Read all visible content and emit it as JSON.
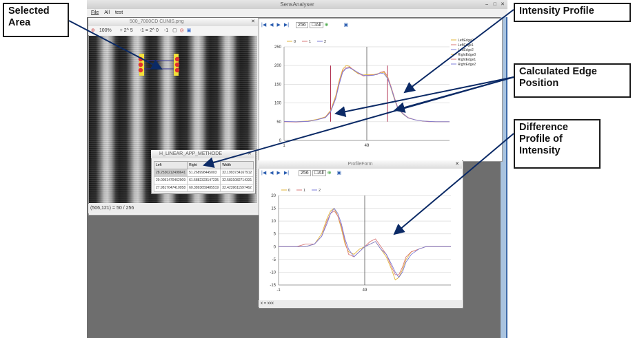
{
  "app": {
    "title": "SensAnalyser",
    "menu": [
      "File",
      "All",
      "test"
    ],
    "window_buttons": [
      "–",
      "□",
      "✕"
    ]
  },
  "image_window": {
    "title": "500_7000CD CUNIS.png",
    "toolbar": {
      "zoom": "100%",
      "gain": "+ 2^ 5",
      "offset": "-1 = 2^ 0",
      "step": "-1"
    },
    "status": "(506,121) = 50 / 256"
  },
  "table_window": {
    "title": "H_LINEAR_APP_METHODE",
    "headers": [
      "Left",
      "Right",
      "Width"
    ],
    "rows": [
      [
        "28.2536212498641",
        "51.268998445003",
        "32.1993734167912"
      ],
      [
        "29.0051470462909",
        "61.5882323147235",
        "32.5831082714331"
      ],
      [
        "27.9817047410958",
        "60.3893659485519",
        "32.4239611597462"
      ]
    ]
  },
  "profile_window": {
    "toolbar": {
      "range": "256",
      "all_label": "All"
    },
    "legend_top": [
      "0",
      "1",
      "2"
    ],
    "legend_right": [
      "LeftEdge0",
      "LeftEdge1",
      "LeftEdge2",
      "RightEdge0",
      "RightEdge1",
      "RightEdge2"
    ]
  },
  "diff_window": {
    "title": "ProfileForm",
    "toolbar": {
      "range": "256",
      "all_label": "All"
    },
    "legend_top": [
      "0",
      "1",
      "2"
    ],
    "status": "x = xxx"
  },
  "callouts": {
    "selected_area": "Selected Area",
    "intensity_profile": "Intensity Profile",
    "edge_position": "Calculated Edge Position",
    "difference_profile": "Difference Profile of Intensity"
  },
  "colors": {
    "series0": "#e2b43a",
    "series1": "#d87a7a",
    "series2": "#7b7bd8",
    "edge": "#b03050",
    "arrow": "#0b2a66"
  },
  "chart_data": [
    {
      "type": "line",
      "title": "",
      "xlabel": "",
      "ylabel": "",
      "xlim": [
        1,
        97
      ],
      "ylim": [
        0,
        250
      ],
      "x_ticks": [
        "1",
        "49"
      ],
      "y_ticks": [
        "0",
        "50",
        "100",
        "150",
        "200",
        "250"
      ],
      "grid": true,
      "legend": "top-right",
      "series": [
        {
          "name": "0",
          "x": [
            1,
            8,
            15,
            20,
            25,
            28,
            31,
            33,
            35,
            37,
            39,
            41,
            44,
            47,
            50,
            53,
            55,
            57,
            59,
            61,
            63,
            65,
            67,
            70,
            73,
            77,
            81,
            85,
            89,
            93,
            97
          ],
          "values": [
            50,
            50,
            52,
            56,
            63,
            80,
            120,
            160,
            190,
            200,
            198,
            188,
            178,
            175,
            176,
            176,
            178,
            180,
            182,
            168,
            140,
            110,
            85,
            70,
            60,
            55,
            52,
            51,
            50,
            50,
            50
          ]
        },
        {
          "name": "1",
          "x": [
            1,
            8,
            15,
            20,
            25,
            28,
            31,
            33,
            35,
            37,
            39,
            41,
            44,
            47,
            50,
            53,
            55,
            57,
            59,
            61,
            63,
            65,
            67,
            70,
            73,
            77,
            81,
            85,
            89,
            93,
            97
          ],
          "values": [
            50,
            49,
            51,
            55,
            62,
            78,
            115,
            155,
            185,
            195,
            196,
            190,
            180,
            172,
            174,
            175,
            176,
            182,
            185,
            172,
            145,
            115,
            88,
            72,
            61,
            55,
            52,
            50,
            50,
            50,
            50
          ]
        },
        {
          "name": "2",
          "x": [
            1,
            8,
            15,
            20,
            25,
            28,
            31,
            33,
            35,
            37,
            39,
            41,
            44,
            47,
            50,
            53,
            55,
            57,
            59,
            61,
            63,
            65,
            67,
            70,
            73,
            77,
            81,
            85,
            89,
            93,
            97
          ],
          "values": [
            51,
            50,
            51,
            55,
            61,
            76,
            112,
            150,
            182,
            192,
            194,
            189,
            181,
            174,
            173,
            174,
            177,
            180,
            178,
            166,
            142,
            112,
            86,
            71,
            60,
            55,
            52,
            51,
            50,
            50,
            50
          ]
        }
      ],
      "edges": {
        "left": 28,
        "right": 61,
        "range": [
          50,
          200
        ]
      }
    },
    {
      "type": "line",
      "title": "",
      "xlabel": "",
      "ylabel": "",
      "xlim": [
        1,
        97
      ],
      "ylim": [
        -15,
        20
      ],
      "x_ticks": [
        "-1",
        "49"
      ],
      "y_ticks": [
        "-15",
        "-10",
        "-5",
        "0",
        "5",
        "10",
        "15",
        "20"
      ],
      "grid": true,
      "legend": "top-left",
      "series": [
        {
          "name": "0",
          "x": [
            1,
            6,
            11,
            16,
            21,
            25,
            28,
            30,
            32,
            34,
            36,
            38,
            40,
            43,
            46,
            49,
            52,
            55,
            58,
            61,
            64,
            66,
            68,
            70,
            72,
            75,
            79,
            83,
            88,
            92,
            97
          ],
          "values": [
            0,
            0,
            0,
            0,
            1,
            5,
            11,
            14,
            15,
            12,
            7,
            1,
            -2,
            -3,
            -1,
            0,
            1,
            2,
            -1,
            -4,
            -9,
            -13,
            -12,
            -9,
            -5,
            -2,
            -1,
            0,
            0,
            0,
            0
          ]
        },
        {
          "name": "1",
          "x": [
            1,
            6,
            11,
            16,
            21,
            25,
            28,
            30,
            32,
            34,
            36,
            38,
            40,
            43,
            46,
            49,
            52,
            55,
            58,
            61,
            64,
            66,
            68,
            70,
            72,
            75,
            79,
            83,
            88,
            92,
            97
          ],
          "values": [
            0,
            0,
            0,
            1,
            1,
            4,
            10,
            13,
            14,
            12,
            8,
            2,
            -3,
            -4,
            -2,
            0,
            2,
            3,
            0,
            -3,
            -8,
            -11,
            -11,
            -8,
            -4,
            -2,
            -1,
            0,
            0,
            0,
            0
          ]
        },
        {
          "name": "2",
          "x": [
            1,
            6,
            11,
            16,
            21,
            25,
            28,
            30,
            32,
            34,
            36,
            38,
            40,
            43,
            46,
            49,
            52,
            55,
            58,
            61,
            64,
            66,
            68,
            70,
            72,
            75,
            79,
            83,
            88,
            92,
            97
          ],
          "values": [
            0,
            0,
            0,
            0,
            1,
            4,
            9,
            13,
            15,
            13,
            9,
            3,
            -1,
            -4,
            -2,
            0,
            1,
            2,
            -1,
            -3,
            -7,
            -10,
            -12,
            -10,
            -6,
            -3,
            -1,
            0,
            0,
            0,
            0
          ]
        }
      ]
    }
  ]
}
